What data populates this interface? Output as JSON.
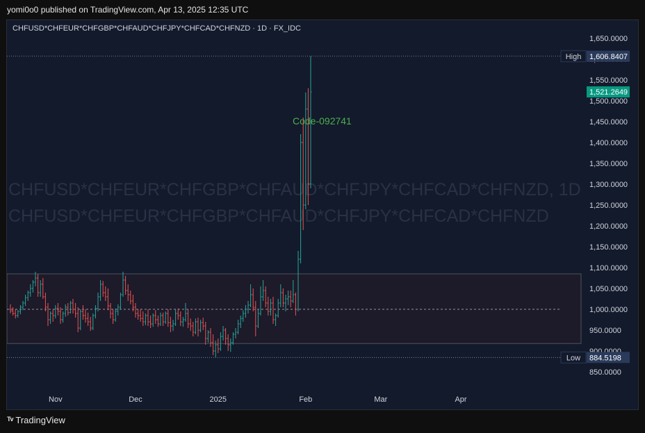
{
  "header": {
    "publisher_line": "yomi0o0 published on TradingView.com, Apr 13, 2025 12:35 UTC",
    "symbol_line": "CHFUSD*CHFEUR*CHFGBP*CHFAUD*CHFJPY*CHFCAD*CHFNZD · 1D · FX_IDC"
  },
  "watermark": {
    "line1": "CHFUSD*CHFEUR*CHFGBP*CHFAUD*CHFJPY*CHFCAD*CHFNZD, 1D",
    "line2": "CHFUSD*CHFEUR*CHFGBP*CHFAUD*CHFJPY*CHFCAD*CHFNZD"
  },
  "annotation": {
    "code_text": "Code-092741",
    "color": "#4caf50"
  },
  "footer": {
    "brand": "TradingView",
    "logo_icon": "tradingview-logo-icon"
  },
  "colors": {
    "up": "#26a69a",
    "down": "#ef5350",
    "background": "#131a2b",
    "high_badge": "#2a3a5a",
    "last_badge": "#089981"
  },
  "chart_data": {
    "type": "ohlc",
    "title": "CHFUSD*CHFEUR*CHFGBP*CHFAUD*CHFJPY*CHFCAD*CHFNZD · 1D · FX_IDC",
    "ylim": [
      800,
      1690
    ],
    "y_ticks": [
      "1,650.0000",
      "1,600.0000",
      "1,550.0000",
      "1,500.0000",
      "1,450.0000",
      "1,400.0000",
      "1,350.0000",
      "1,300.0000",
      "1,250.0000",
      "1,200.0000",
      "1,150.0000",
      "1,100.0000",
      "1,050.0000",
      "1,000.0000",
      "950.0000",
      "900.0000",
      "850.0000"
    ],
    "y_tick_values": [
      1650,
      1600,
      1550,
      1500,
      1450,
      1400,
      1350,
      1300,
      1250,
      1200,
      1150,
      1100,
      1050,
      1000,
      950,
      900,
      850
    ],
    "x_labels": [
      {
        "label": "Nov",
        "index": 18
      },
      {
        "label": "Dec",
        "index": 50
      },
      {
        "label": "2025",
        "index": 83
      },
      {
        "label": "Feb",
        "index": 118
      },
      {
        "label": "Mar",
        "index": 148
      },
      {
        "label": "Apr",
        "index": 180
      }
    ],
    "high": {
      "label": "High",
      "value": 1606.8407,
      "text": "1,606.8407"
    },
    "low": {
      "label": "Low",
      "value": 884.5198,
      "text": "884.5198"
    },
    "last": {
      "value": 1521.2649,
      "text": "1,521.2649"
    },
    "reference_level": 1000,
    "range_box": {
      "top": 1085,
      "bottom": 918
    },
    "bars": [
      [
        1000,
        1012,
        990,
        996
      ],
      [
        996,
        1005,
        985,
        990
      ],
      [
        990,
        1000,
        978,
        985
      ],
      [
        985,
        998,
        980,
        995
      ],
      [
        995,
        1010,
        988,
        1005
      ],
      [
        1005,
        1020,
        998,
        1015
      ],
      [
        1015,
        1035,
        1008,
        1028
      ],
      [
        1028,
        1045,
        1020,
        1040
      ],
      [
        1040,
        1060,
        1030,
        1050
      ],
      [
        1050,
        1070,
        1040,
        1065
      ],
      [
        1065,
        1090,
        1055,
        1075
      ],
      [
        1075,
        1085,
        1030,
        1040
      ],
      [
        1040,
        1070,
        1030,
        1060
      ],
      [
        1060,
        1075,
        1025,
        1030
      ],
      [
        1030,
        1040,
        995,
        1005
      ],
      [
        1005,
        1015,
        960,
        975
      ],
      [
        975,
        995,
        965,
        990
      ],
      [
        990,
        1000,
        970,
        985
      ],
      [
        985,
        1010,
        978,
        1002
      ],
      [
        1002,
        1015,
        985,
        995
      ],
      [
        995,
        1005,
        965,
        975
      ],
      [
        975,
        995,
        968,
        990
      ],
      [
        990,
        1012,
        982,
        1005
      ],
      [
        1005,
        1015,
        985,
        992
      ],
      [
        992,
        1020,
        990,
        1015
      ],
      [
        1015,
        1025,
        990,
        1000
      ],
      [
        1000,
        1015,
        980,
        990
      ],
      [
        990,
        1005,
        945,
        955
      ],
      [
        955,
        1000,
        950,
        995
      ],
      [
        995,
        1010,
        975,
        985
      ],
      [
        985,
        1000,
        968,
        978
      ],
      [
        978,
        992,
        960,
        970
      ],
      [
        970,
        982,
        948,
        955
      ],
      [
        955,
        990,
        950,
        985
      ],
      [
        985,
        1010,
        978,
        1002
      ],
      [
        1002,
        1040,
        995,
        1030
      ],
      [
        1030,
        1070,
        1020,
        1060
      ],
      [
        1060,
        1068,
        1030,
        1040
      ],
      [
        1040,
        1055,
        1020,
        1030
      ],
      [
        1030,
        1050,
        998,
        1008
      ],
      [
        1008,
        1015,
        978,
        990
      ],
      [
        990,
        1000,
        965,
        975
      ],
      [
        975,
        1002,
        970,
        995
      ],
      [
        995,
        1012,
        985,
        1005
      ],
      [
        1005,
        1040,
        1000,
        1035
      ],
      [
        1035,
        1090,
        1030,
        1070
      ],
      [
        1070,
        1080,
        1035,
        1045
      ],
      [
        1045,
        1060,
        1020,
        1035
      ],
      [
        1035,
        1045,
        1012,
        1020
      ],
      [
        1020,
        1035,
        995,
        1005
      ],
      [
        1005,
        1015,
        980,
        990
      ],
      [
        990,
        1000,
        975,
        985
      ],
      [
        985,
        1000,
        970,
        978
      ],
      [
        978,
        995,
        960,
        970
      ],
      [
        970,
        990,
        962,
        985
      ],
      [
        985,
        1000,
        960,
        970
      ],
      [
        970,
        985,
        955,
        965
      ],
      [
        965,
        990,
        958,
        985
      ],
      [
        985,
        998,
        965,
        975
      ],
      [
        975,
        985,
        958,
        965
      ],
      [
        965,
        992,
        960,
        985
      ],
      [
        985,
        992,
        960,
        970
      ],
      [
        970,
        995,
        965,
        990
      ],
      [
        990,
        1000,
        958,
        968
      ],
      [
        968,
        982,
        945,
        960
      ],
      [
        960,
        975,
        948,
        965
      ],
      [
        965,
        1000,
        960,
        990
      ],
      [
        990,
        1002,
        975,
        985
      ],
      [
        985,
        995,
        960,
        970
      ],
      [
        970,
        982,
        958,
        975
      ],
      [
        975,
        1015,
        970,
        990
      ],
      [
        990,
        1000,
        955,
        965
      ],
      [
        965,
        978,
        948,
        960
      ],
      [
        960,
        970,
        935,
        945
      ],
      [
        945,
        978,
        940,
        970
      ],
      [
        970,
        980,
        935,
        950
      ],
      [
        950,
        975,
        945,
        968
      ],
      [
        968,
        980,
        950,
        960
      ],
      [
        960,
        970,
        915,
        930
      ],
      [
        930,
        950,
        920,
        945
      ],
      [
        945,
        955,
        910,
        920
      ],
      [
        920,
        940,
        890,
        900
      ],
      [
        900,
        925,
        885,
        915
      ],
      [
        915,
        930,
        895,
        905
      ],
      [
        905,
        945,
        900,
        935
      ],
      [
        935,
        960,
        925,
        950
      ],
      [
        950,
        955,
        915,
        930
      ],
      [
        930,
        940,
        900,
        915
      ],
      [
        915,
        930,
        898,
        920
      ],
      [
        920,
        945,
        915,
        940
      ],
      [
        940,
        955,
        930,
        945
      ],
      [
        945,
        975,
        940,
        965
      ],
      [
        965,
        985,
        955,
        978
      ],
      [
        978,
        998,
        970,
        990
      ],
      [
        990,
        1010,
        980,
        1000
      ],
      [
        1000,
        1020,
        990,
        1010
      ],
      [
        1010,
        1060,
        1005,
        1035
      ],
      [
        1035,
        1050,
        995,
        1005
      ],
      [
        1005,
        1020,
        935,
        960
      ],
      [
        960,
        1000,
        955,
        990
      ],
      [
        990,
        1055,
        985,
        1030
      ],
      [
        1030,
        1070,
        1020,
        1045
      ],
      [
        1045,
        1055,
        1005,
        1015
      ],
      [
        1015,
        1030,
        985,
        995
      ],
      [
        995,
        1025,
        985,
        1015
      ],
      [
        1015,
        1030,
        965,
        975
      ],
      [
        975,
        990,
        960,
        985
      ],
      [
        985,
        1025,
        980,
        1015
      ],
      [
        1015,
        1060,
        1005,
        1040
      ],
      [
        1040,
        1050,
        1005,
        1015
      ],
      [
        1015,
        1035,
        995,
        1025
      ],
      [
        1025,
        1045,
        1010,
        1030
      ],
      [
        1030,
        1045,
        1005,
        1020
      ],
      [
        1020,
        1070,
        1015,
        1035
      ],
      [
        1035,
        1040,
        985,
        1000
      ],
      [
        1000,
        1140,
        995,
        1120
      ],
      [
        1120,
        1420,
        1110,
        1400
      ],
      [
        1400,
        1460,
        1190,
        1250
      ],
      [
        1250,
        1520,
        1240,
        1480
      ],
      [
        1480,
        1530,
        1250,
        1300
      ],
      [
        1300,
        1606.84,
        1290,
        1521.26
      ]
    ]
  }
}
